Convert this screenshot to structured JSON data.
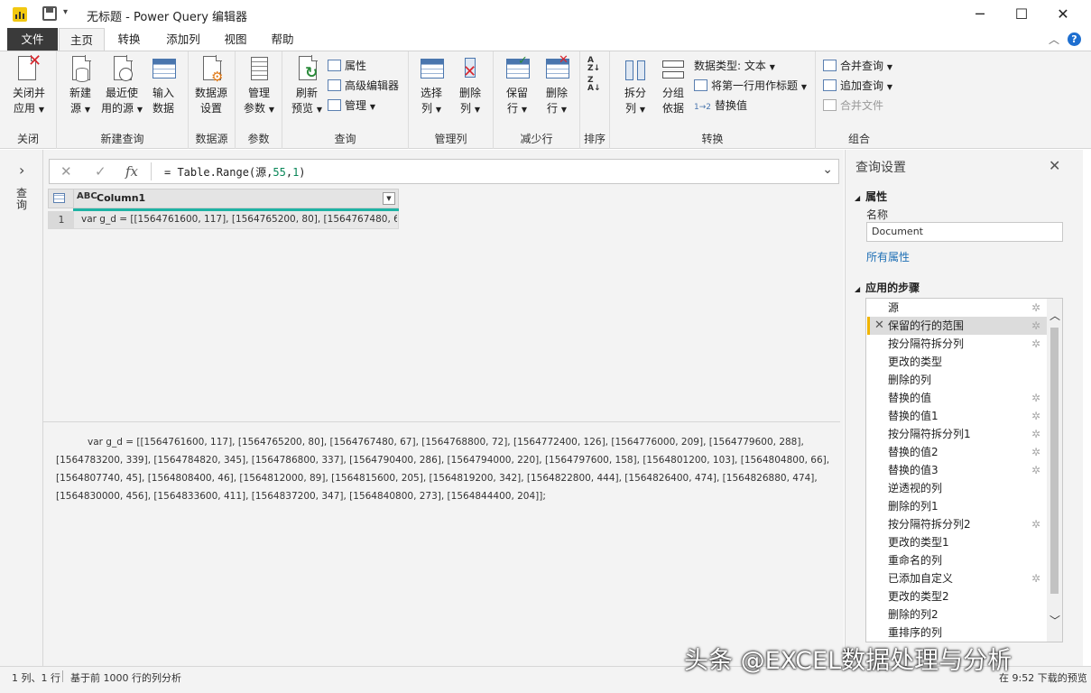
{
  "window": {
    "title": "无标题 - Power Query 编辑器",
    "minimize": "─",
    "maximize": "☐",
    "close": "✕"
  },
  "tabs": [
    "文件",
    "主页",
    "转换",
    "添加列",
    "视图",
    "帮助"
  ],
  "active_tab": "主页",
  "help_glyph": "?",
  "ribbon": {
    "groups": {
      "close": "关闭",
      "new_query": "新建查询",
      "datasource": "数据源",
      "params": "参数",
      "query": "查询",
      "manage_cols": "管理列",
      "reduce_rows": "减少行",
      "sort": "排序",
      "transform": "转换",
      "combine": "组合"
    },
    "close_apply": [
      "关闭并",
      "应用"
    ],
    "new_source": [
      "新建",
      "源"
    ],
    "recent_sources": [
      "最近使",
      "用的源"
    ],
    "enter_data": [
      "输入",
      "数据"
    ],
    "datasource_settings": [
      "数据源",
      "设置"
    ],
    "manage_params": [
      "管理",
      "参数"
    ],
    "refresh_preview": [
      "刷新",
      "预览"
    ],
    "properties": "属性",
    "advanced_editor": "高级编辑器",
    "manage": "管理",
    "choose_columns": [
      "选择",
      "列"
    ],
    "remove_columns": [
      "删除",
      "列"
    ],
    "keep_rows": [
      "保留",
      "行"
    ],
    "remove_rows": [
      "删除",
      "行"
    ],
    "split_column": [
      "拆分",
      "列"
    ],
    "group_by": [
      "分组",
      "依据"
    ],
    "data_type": "数据类型: 文本",
    "use_first_row": "将第一行用作标题",
    "replace_values": "替换值",
    "merge_queries": "合并查询",
    "append_queries": "追加查询",
    "combine_files": "合并文件"
  },
  "queries_pane_label": "查询",
  "formula": {
    "prefix": "= Table.Range(源,",
    "arg1": "55",
    "comma": ",",
    "arg2": "1",
    "suffix": ")"
  },
  "table": {
    "column_name": "Column1",
    "column_type": "ABC",
    "rows": [
      {
        "num": "1",
        "value": "var g_d = [[1564761600, 117], [1564765200, 80], [1564767480, 67], [1564768800, 72], [1564772400, 126], [1564776000, 209], [1564779600, 288], [1564783200, 339], [1564784820, 345], [1564786800, 337], [1564790400, 286], [1564794000, 220], [1564797600, 158], [1564801200, 103], [1564804800, 66], [1564807740, 45], [1564808400, 46], [1564812000, 89], [1564815600, 205], [1564819200, 342], [1564822800, 444], [1564826400, 474], [1564826880, 474], [1564830000, 456], [1564833600, 411], [1564837200, 347], [1564840800, 273], [1564844400, 204]];"
      }
    ]
  },
  "preview_text": "var g_d = [[1564761600, 117], [1564765200, 80], [1564767480, 67], [1564768800, 72], [1564772400, 126], [1564776000, 209], [1564779600, 288], [1564783200, 339], [1564784820, 345], [1564786800, 337], [1564790400, 286], [1564794000, 220], [1564797600, 158], [1564801200, 103], [1564804800, 66], [1564807740, 45], [1564808400, 46], [1564812000, 89], [1564815600, 205], [1564819200, 342], [1564822800, 444], [1564826400, 474], [1564826880, 474], [1564830000, 456], [1564833600, 411], [1564837200, 347], [1564840800, 273], [1564844400, 204]];",
  "settings": {
    "title": "查询设置",
    "properties": "属性",
    "name_label": "名称",
    "name_value": "Document",
    "all_properties": "所有属性",
    "applied_steps": "应用的步骤",
    "steps": [
      {
        "label": "源",
        "gear": true,
        "selected": false
      },
      {
        "label": "保留的行的范围",
        "gear": true,
        "selected": true
      },
      {
        "label": "按分隔符拆分列",
        "gear": true,
        "selected": false
      },
      {
        "label": "更改的类型",
        "gear": false,
        "selected": false
      },
      {
        "label": "删除的列",
        "gear": false,
        "selected": false
      },
      {
        "label": "替换的值",
        "gear": true,
        "selected": false
      },
      {
        "label": "替换的值1",
        "gear": true,
        "selected": false
      },
      {
        "label": "按分隔符拆分列1",
        "gear": true,
        "selected": false
      },
      {
        "label": "替换的值2",
        "gear": true,
        "selected": false
      },
      {
        "label": "替换的值3",
        "gear": true,
        "selected": false
      },
      {
        "label": "逆透视的列",
        "gear": false,
        "selected": false
      },
      {
        "label": "删除的列1",
        "gear": false,
        "selected": false
      },
      {
        "label": "按分隔符拆分列2",
        "gear": true,
        "selected": false
      },
      {
        "label": "更改的类型1",
        "gear": false,
        "selected": false
      },
      {
        "label": "重命名的列",
        "gear": false,
        "selected": false
      },
      {
        "label": "已添加自定义",
        "gear": true,
        "selected": false
      },
      {
        "label": "更改的类型2",
        "gear": false,
        "selected": false
      },
      {
        "label": "删除的列2",
        "gear": false,
        "selected": false
      },
      {
        "label": "重排序的列",
        "gear": false,
        "selected": false
      }
    ]
  },
  "status": {
    "cols_rows": "1 列、1 行",
    "profiling": "基于前 1000 行的列分析",
    "download": "在 9:52 下载的预览"
  },
  "watermark": "头条 @EXCEL数据处理与分析",
  "colors": {
    "accent": "#1e6fd0",
    "file_tab": "#3a3a3a",
    "quality_bar": "#1fb3a4",
    "selected_step_marker": "#f0b400"
  }
}
